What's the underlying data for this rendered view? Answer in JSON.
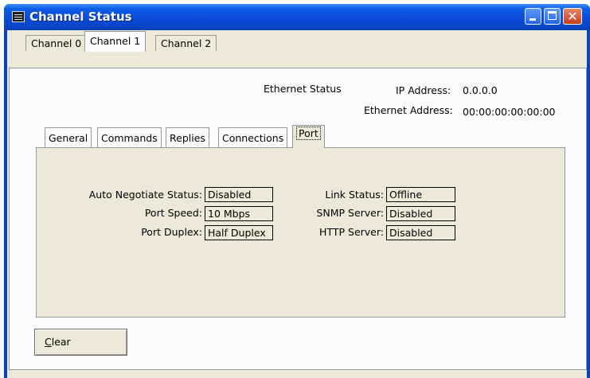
{
  "window": {
    "title": "Channel Status",
    "close_glyph": "✕"
  },
  "outer_tabs": [
    {
      "label": "Channel 0",
      "active": false
    },
    {
      "label": "Channel 1",
      "active": true
    },
    {
      "label": "Channel 2",
      "active": false
    }
  ],
  "ethernet": {
    "status_label": "Ethernet Status",
    "ip_label": "IP Address:",
    "ip_value": "0.0.0.0",
    "mac_label": "Ethernet Address:",
    "mac_value": "00:00:00:00:00:00"
  },
  "inner_tabs": [
    {
      "label": "General",
      "active": false
    },
    {
      "label": "Commands",
      "active": false
    },
    {
      "label": "Replies",
      "active": false
    },
    {
      "label": "Connections",
      "active": false
    },
    {
      "label": "Port",
      "active": true
    }
  ],
  "port": {
    "auto_negotiate_label": "Auto Negotiate Status:",
    "auto_negotiate_value": "Disabled",
    "port_speed_label": "Port Speed:",
    "port_speed_value": "10 Mbps",
    "port_duplex_label": "Port Duplex:",
    "port_duplex_value": "Half Duplex",
    "link_status_label": "Link Status:",
    "link_status_value": "Offline",
    "snmp_label": "SNMP Server:",
    "snmp_value": "Disabled",
    "http_label": "HTTP Server:",
    "http_value": "Disabled"
  },
  "clear_button": {
    "label_first": "C",
    "label_rest": "lear"
  },
  "colors": {
    "titlebar": "#0A4AD8",
    "dialog_bg": "#ECE9D8",
    "close_button": "#C63E1B"
  }
}
